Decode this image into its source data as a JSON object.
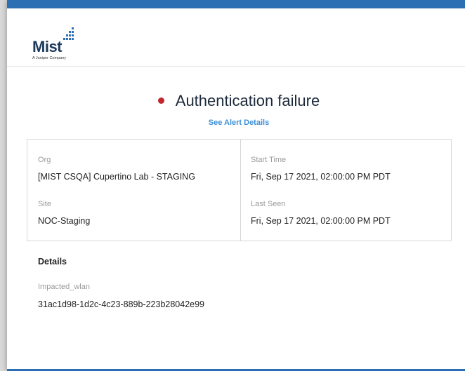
{
  "colors": {
    "top_bar": "#2d6fb3",
    "alert_dot": "#c0282f",
    "link": "#3b8fd6",
    "logo_dots": "#2d6fb3"
  },
  "logo": {
    "wordmark": "Mist",
    "tagline": "A Juniper Company",
    "icon": "mist-dots-logo-icon"
  },
  "alert": {
    "title": "Authentication failure",
    "status_icon": "red-dot-icon",
    "details_link": "See Alert Details"
  },
  "info": {
    "org_label": "Org",
    "org_value": "[MIST CSQA] Cupertino Lab - STAGING",
    "site_label": "Site",
    "site_value": "NOC-Staging",
    "start_label": "Start Time",
    "start_value": "Fri, Sep 17 2021, 02:00:00 PM PDT",
    "last_label": "Last Seen",
    "last_value": "Fri, Sep 17 2021, 02:00:00 PM PDT"
  },
  "details": {
    "heading": "Details",
    "field_label": "Impacted_wlan",
    "field_value": "31ac1d98-1d2c-4c23-889b-223b28042e99"
  }
}
